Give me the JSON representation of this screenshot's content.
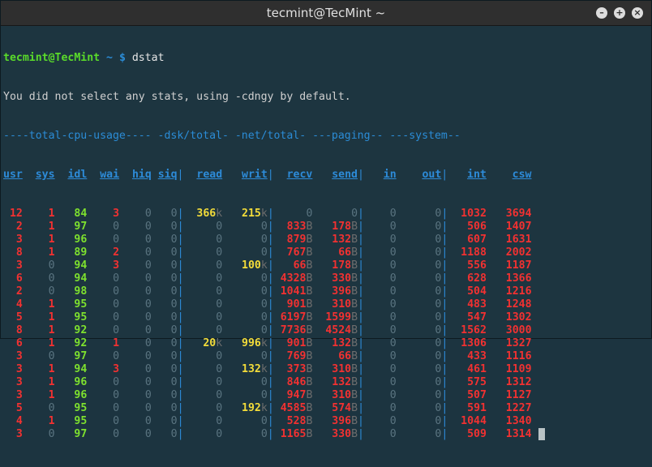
{
  "window": {
    "title": "tecmint@TecMint ~",
    "buttons": [
      "–",
      "+",
      "×"
    ]
  },
  "prompt": {
    "user_host": "tecmint@TecMint",
    "path": "~",
    "symbol": "$",
    "command": "dstat"
  },
  "message": "You did not select any stats, using -cdngy by default.",
  "group_header": "----total-cpu-usage---- -dsk/total- -net/total- ---paging-- ---system--",
  "columns": [
    "usr",
    "sys",
    "idl",
    "wai",
    "hiq",
    "siq",
    "read",
    "writ",
    "recv",
    "send",
    "in",
    "out",
    "int",
    "csw"
  ],
  "rows": [
    [
      "12",
      "1",
      "84",
      "3",
      "0",
      "0",
      "366k",
      "215k",
      "0",
      "0",
      "0",
      "0",
      "1032",
      "3694"
    ],
    [
      "2",
      "1",
      "97",
      "0",
      "0",
      "0",
      "0",
      "0",
      "833B",
      "178B",
      "0",
      "0",
      "506",
      "1407"
    ],
    [
      "3",
      "1",
      "96",
      "0",
      "0",
      "0",
      "0",
      "0",
      "879B",
      "132B",
      "0",
      "0",
      "607",
      "1631"
    ],
    [
      "8",
      "1",
      "89",
      "2",
      "0",
      "0",
      "0",
      "0",
      "767B",
      "66B",
      "0",
      "0",
      "1188",
      "2002"
    ],
    [
      "3",
      "0",
      "94",
      "3",
      "0",
      "0",
      "0",
      "100k",
      "66B",
      "178B",
      "0",
      "0",
      "556",
      "1187"
    ],
    [
      "6",
      "0",
      "94",
      "0",
      "0",
      "0",
      "0",
      "0",
      "4328B",
      "330B",
      "0",
      "0",
      "628",
      "1366"
    ],
    [
      "2",
      "0",
      "98",
      "0",
      "0",
      "0",
      "0",
      "0",
      "1041B",
      "396B",
      "0",
      "0",
      "504",
      "1216"
    ],
    [
      "4",
      "1",
      "95",
      "0",
      "0",
      "0",
      "0",
      "0",
      "901B",
      "310B",
      "0",
      "0",
      "483",
      "1248"
    ],
    [
      "5",
      "1",
      "95",
      "0",
      "0",
      "0",
      "0",
      "0",
      "6197B",
      "1599B",
      "0",
      "0",
      "547",
      "1302"
    ],
    [
      "8",
      "1",
      "92",
      "0",
      "0",
      "0",
      "0",
      "0",
      "7736B",
      "4524B",
      "0",
      "0",
      "1562",
      "3000"
    ],
    [
      "6",
      "1",
      "92",
      "1",
      "0",
      "0",
      "20k",
      "996k",
      "901B",
      "132B",
      "0",
      "0",
      "1306",
      "1327"
    ],
    [
      "3",
      "0",
      "97",
      "0",
      "0",
      "0",
      "0",
      "0",
      "769B",
      "66B",
      "0",
      "0",
      "433",
      "1116"
    ],
    [
      "3",
      "1",
      "94",
      "3",
      "0",
      "0",
      "0",
      "132k",
      "373B",
      "310B",
      "0",
      "0",
      "461",
      "1109"
    ],
    [
      "3",
      "1",
      "96",
      "0",
      "0",
      "0",
      "0",
      "0",
      "846B",
      "132B",
      "0",
      "0",
      "575",
      "1312"
    ],
    [
      "3",
      "1",
      "96",
      "0",
      "0",
      "0",
      "0",
      "0",
      "947B",
      "310B",
      "0",
      "0",
      "507",
      "1127"
    ],
    [
      "5",
      "0",
      "95",
      "0",
      "0",
      "0",
      "0",
      "192k",
      "4585B",
      "574B",
      "0",
      "0",
      "591",
      "1227"
    ],
    [
      "4",
      "1",
      "95",
      "0",
      "0",
      "0",
      "0",
      "0",
      "528B",
      "396B",
      "0",
      "0",
      "1044",
      "1340"
    ],
    [
      "3",
      "0",
      "97",
      "0",
      "0",
      "0",
      "0",
      "0",
      "1165B",
      "330B",
      "0",
      "0",
      "509",
      "1314"
    ]
  ],
  "colors": {
    "background": "#1d3540",
    "prompt": "#5adb2a",
    "header": "#2d8bd8",
    "cpu_user": "#f23131",
    "cpu_idle": "#7ee12e",
    "disk": "#f3dc3a",
    "zero": "#5a7480",
    "titlebar": "#2f2f2f"
  }
}
